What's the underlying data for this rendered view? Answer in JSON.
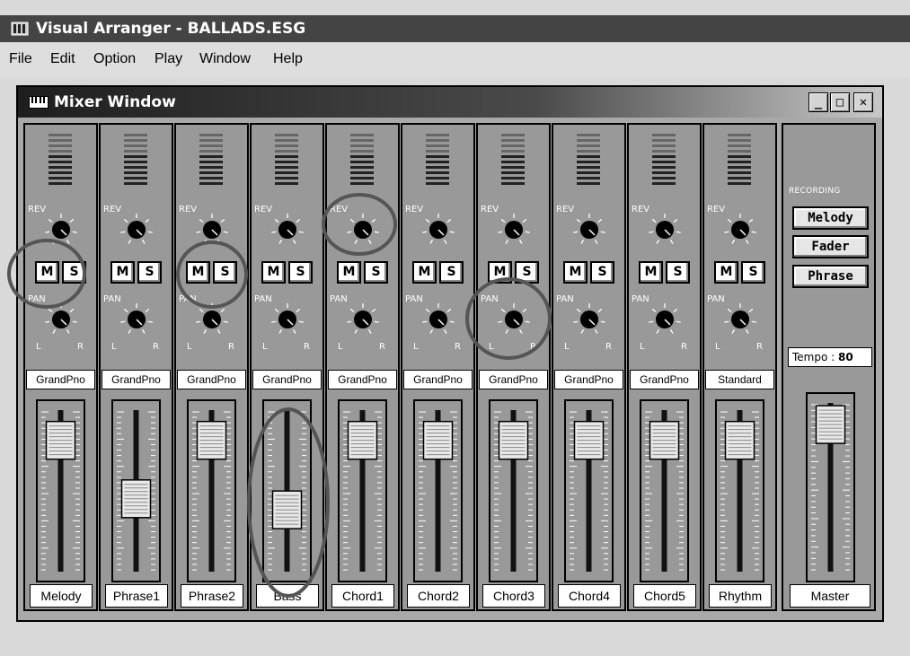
{
  "app": {
    "title": "Visual Arranger - BALLADS.ESG"
  },
  "menu": [
    "File",
    "Edit",
    "Option",
    "Play",
    "Window",
    "Help"
  ],
  "mixer": {
    "title": "Mixer Window",
    "window_buttons": {
      "minimize": "_",
      "maximize": "□",
      "close": "✕"
    },
    "labels": {
      "rev": "REV",
      "pan": "PAN",
      "left": "L",
      "right": "R",
      "mute": "M",
      "solo": "S"
    },
    "channels": [
      {
        "name": "Melody",
        "instrument": "GrandPno",
        "fader_level": 0.82
      },
      {
        "name": "Phrase1",
        "instrument": "GrandPno",
        "fader_level": 0.45
      },
      {
        "name": "Phrase2",
        "instrument": "GrandPno",
        "fader_level": 0.82
      },
      {
        "name": "Bass",
        "instrument": "GrandPno",
        "fader_level": 0.38
      },
      {
        "name": "Chord1",
        "instrument": "GrandPno",
        "fader_level": 0.82
      },
      {
        "name": "Chord2",
        "instrument": "GrandPno",
        "fader_level": 0.82
      },
      {
        "name": "Chord3",
        "instrument": "GrandPno",
        "fader_level": 0.82
      },
      {
        "name": "Chord4",
        "instrument": "GrandPno",
        "fader_level": 0.82
      },
      {
        "name": "Chord5",
        "instrument": "GrandPno",
        "fader_level": 0.82
      },
      {
        "name": "Rhythm",
        "instrument": "Standard",
        "fader_level": 0.82
      }
    ],
    "master": {
      "name": "Master",
      "recording_label": "RECORDING",
      "recording_buttons": [
        "Melody",
        "Fader",
        "Phrase"
      ],
      "tempo_label": "Tempo :",
      "tempo_value": "80",
      "fader_level": 0.88
    }
  },
  "colors": {
    "window_bg": "#a9a9a9",
    "strip_bg": "#999999",
    "title_bar": "#1e1e1e",
    "annotation": "#555555"
  },
  "icons": {
    "app": "keyboard-mixer-icon",
    "mixer": "keyboard-icon"
  }
}
